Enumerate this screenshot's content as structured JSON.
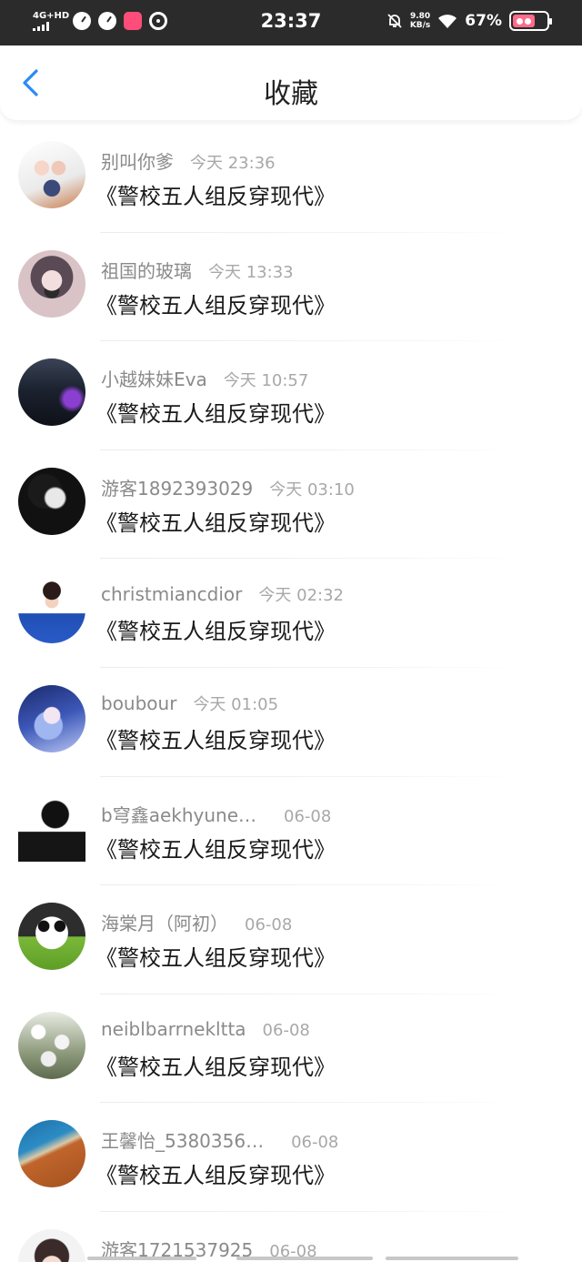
{
  "status_bar": {
    "network": "4G+HD",
    "time": "23:37",
    "speed_value": "9.80",
    "speed_unit": "KB/s",
    "battery": "67%",
    "icons": [
      "speedometer-icon",
      "speedometer-icon",
      "app-icon",
      "sync-icon",
      "bell-off-icon",
      "wifi-icon",
      "battery-icon"
    ]
  },
  "nav": {
    "back_icon": "chevron-left-icon",
    "title": "收藏",
    "accent_color": "#2a8af6"
  },
  "favorites": [
    {
      "username": "别叫你爹",
      "time": "今天 23:36",
      "title": "《警校五人组反穿现代》"
    },
    {
      "username": "祖国的玻璃",
      "time": "今天 13:33",
      "title": "《警校五人组反穿现代》"
    },
    {
      "username": "小越妹妹Eva",
      "time": "今天 10:57",
      "title": "《警校五人组反穿现代》"
    },
    {
      "username": "游客1892393029",
      "time": "今天 03:10",
      "title": "《警校五人组反穿现代》"
    },
    {
      "username": "christmiancdior",
      "time": "今天 02:32",
      "title": "《警校五人组反穿现代》"
    },
    {
      "username": "boubour",
      "time": "今天 01:05",
      "title": "《警校五人组反穿现代》"
    },
    {
      "username": "b穹鑫aekhyune…",
      "time": "06-08",
      "title": "《警校五人组反穿现代》"
    },
    {
      "username": "海棠月（阿初）",
      "time": "06-08",
      "title": "《警校五人组反穿现代》"
    },
    {
      "username": "neiblbarrnekltta",
      "time": "06-08",
      "title": "《警校五人组反穿现代》"
    },
    {
      "username": "王馨怡_5380356…",
      "time": "06-08",
      "title": "《警校五人组反穿现代》"
    },
    {
      "username": "游客1721537925",
      "time": "06-08",
      "title": ""
    }
  ]
}
